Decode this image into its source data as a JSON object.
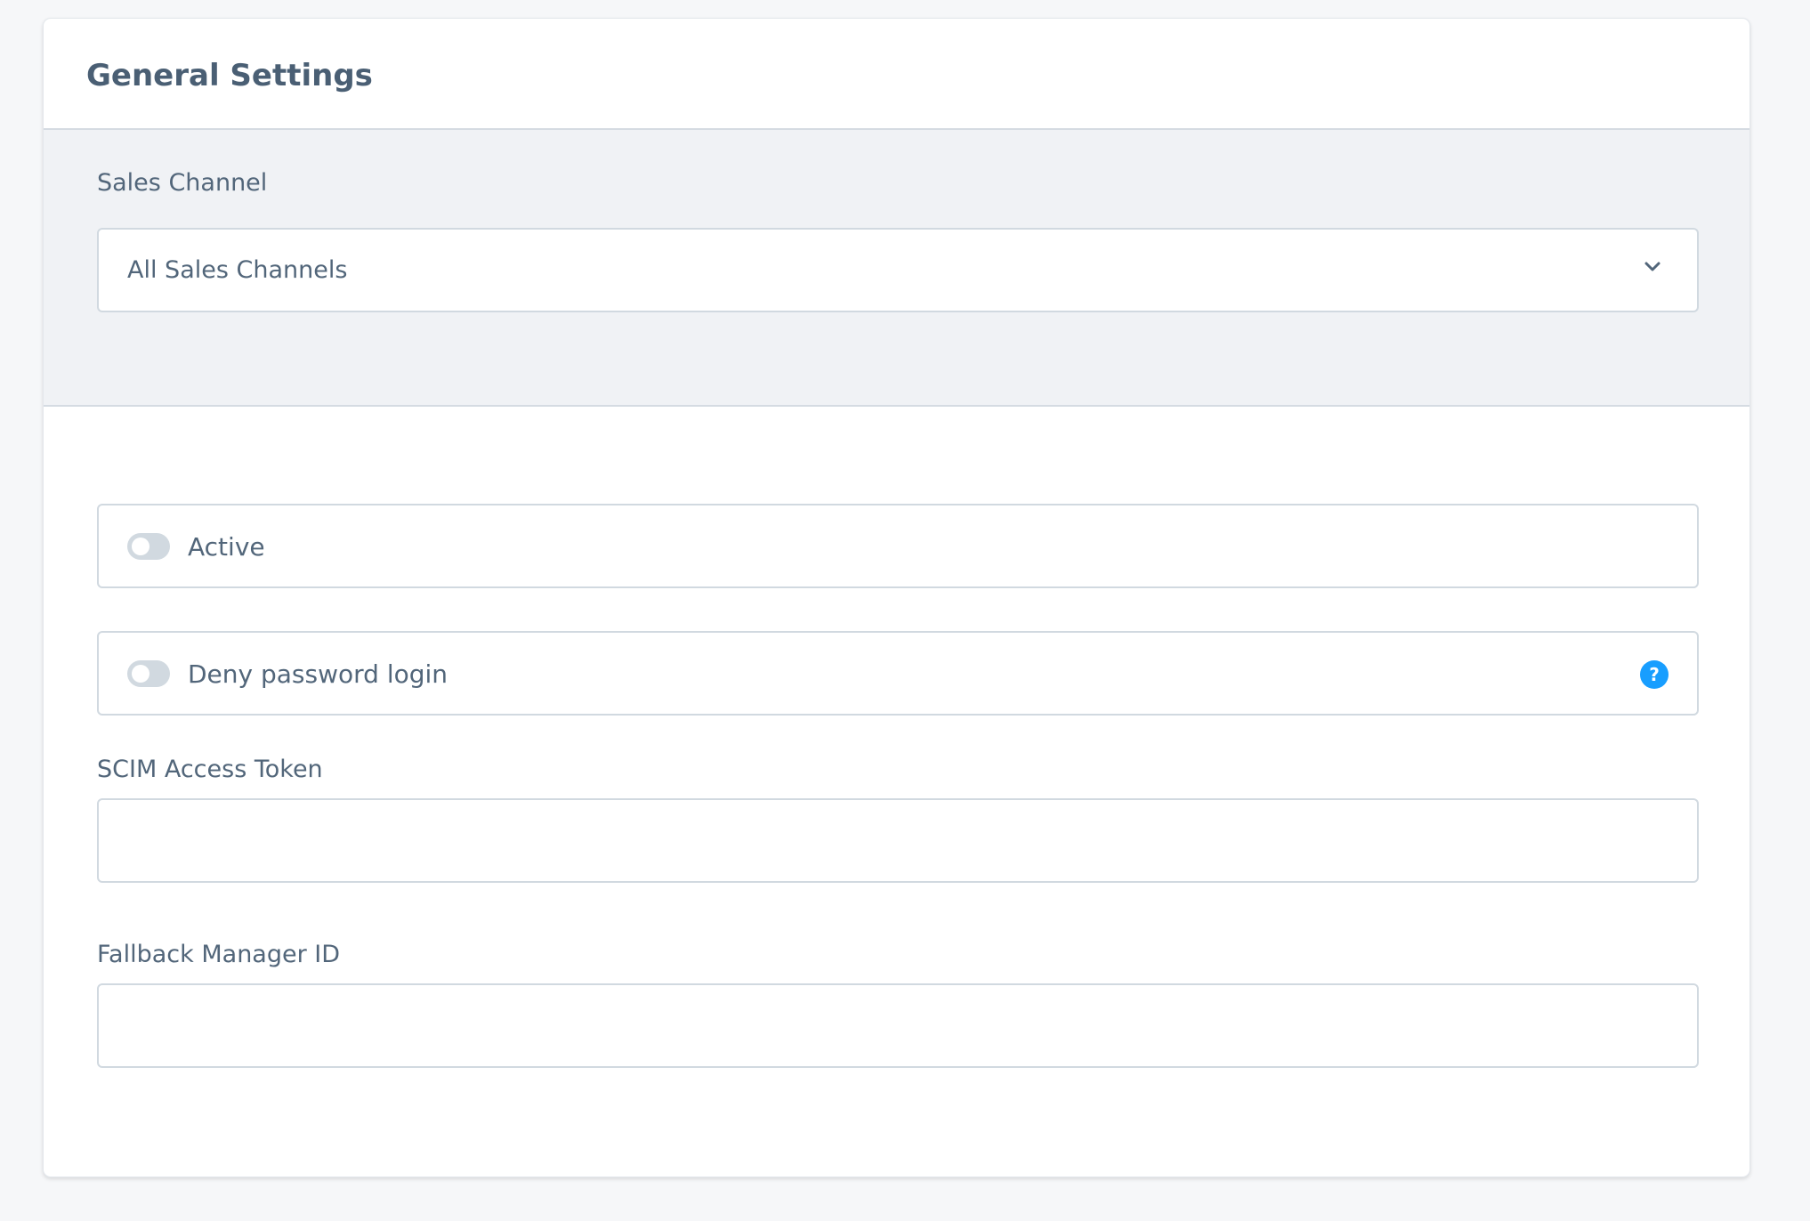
{
  "card": {
    "title": "General Settings"
  },
  "sales_channel": {
    "label": "Sales Channel",
    "selected": "All Sales Channels",
    "icon": "chevron-down-icon"
  },
  "active_switch": {
    "label": "Active",
    "checked": false
  },
  "deny_password_switch": {
    "label": "Deny password login",
    "checked": false,
    "help_icon": "help-icon",
    "help_glyph": "?",
    "help_color": "#189eff"
  },
  "scim_token": {
    "label": "SCIM Access Token",
    "value": "",
    "placeholder": ""
  },
  "fallback_manager": {
    "label": "Fallback Manager ID",
    "value": "",
    "placeholder": ""
  }
}
